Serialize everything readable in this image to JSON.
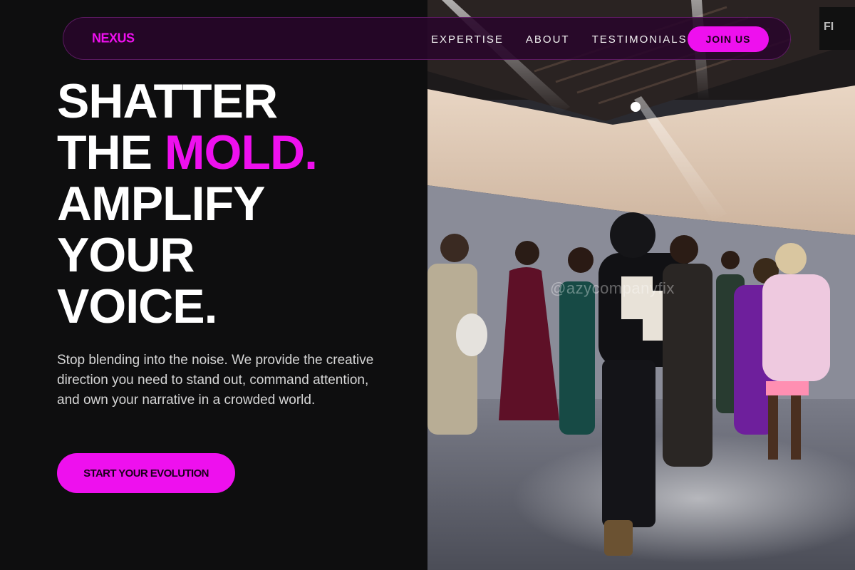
{
  "nav": {
    "logo": "NEXUS",
    "links": [
      "EXPERTISE",
      "ABOUT",
      "TESTIMONIALS"
    ],
    "cta": "JOIN US"
  },
  "hero": {
    "line1": "SHATTER",
    "line2_white": "THE ",
    "line2_accent": "MOLD.",
    "line3": "AMPLIFY",
    "line4": "YOUR",
    "line5": "VOICE.",
    "subtext": "Stop blending into the noise. We provide the creative direction you need to stand out, command attention, and own your narrative in a crowded world.",
    "cta": "START YOUR EVOLUTION"
  },
  "photo": {
    "subject": "fashion-show-backstage-photo",
    "watermark": "@azycompanyfix"
  },
  "colors": {
    "accent": "#ee10ee",
    "background": "#0e0e0f",
    "nav_background": "#28062a"
  }
}
